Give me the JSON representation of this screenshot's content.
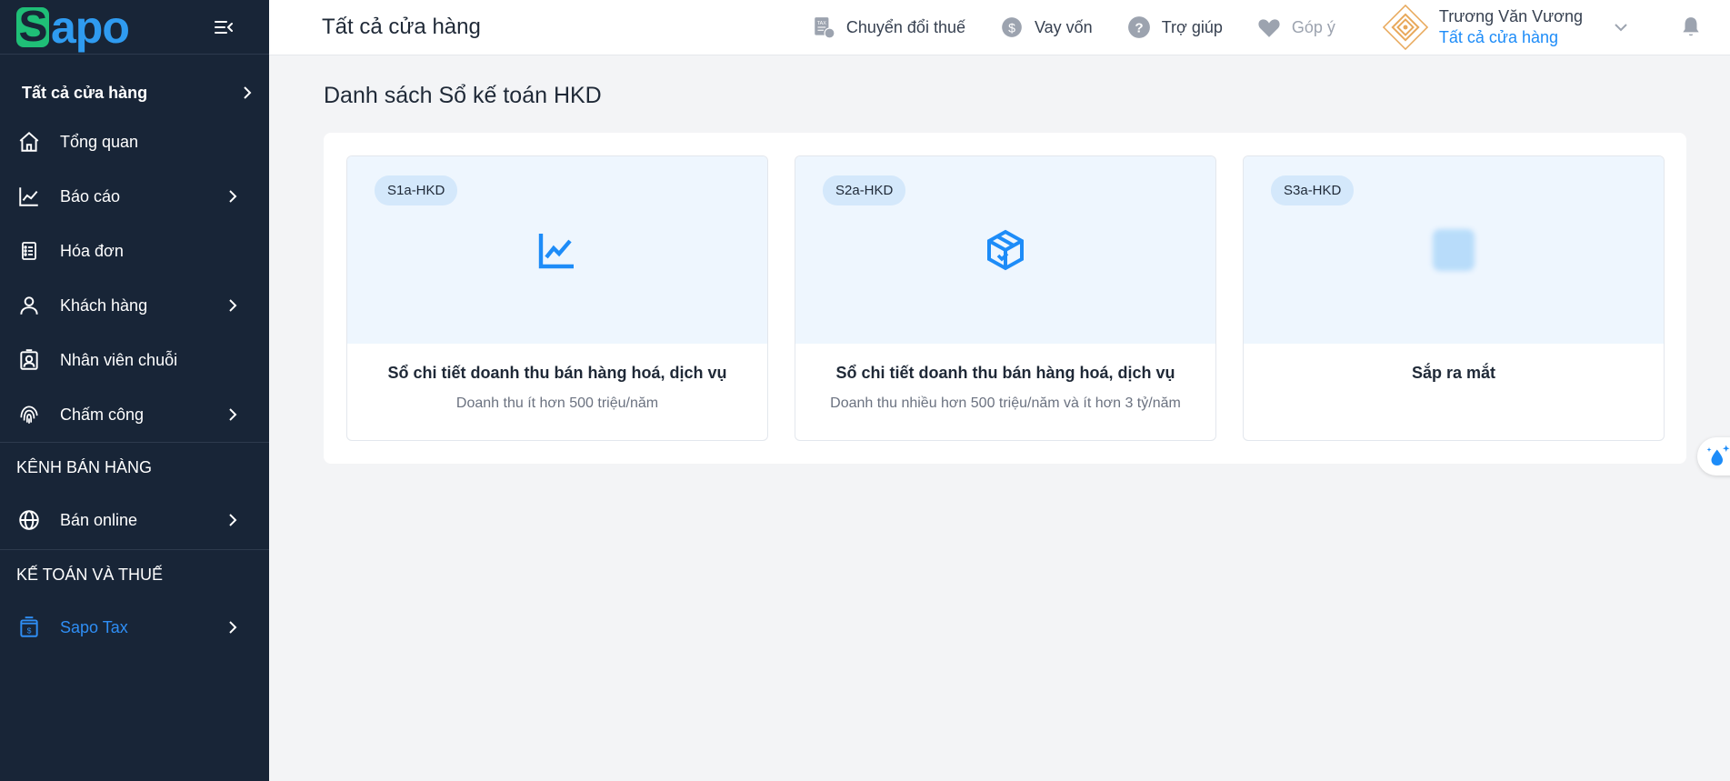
{
  "brand": {
    "logo_text": "apo",
    "logo_initial": "S"
  },
  "sidebar": {
    "store_label": "Tất cả cửa hàng",
    "items": [
      {
        "label": "Tổng quan",
        "icon": "home-icon"
      },
      {
        "label": "Báo cáo",
        "icon": "chart-line-icon"
      },
      {
        "label": "Hóa đơn",
        "icon": "invoice-icon"
      },
      {
        "label": "Khách hàng",
        "icon": "user-icon"
      },
      {
        "label": "Nhân viên chuỗi",
        "icon": "employee-badge-icon"
      },
      {
        "label": "Chấm công",
        "icon": "fingerprint-icon"
      }
    ],
    "section_sales": "KÊNH BÁN HÀNG",
    "sales_items": [
      {
        "label": "Bán online",
        "icon": "globe-icon"
      }
    ],
    "section_tax": "KẾ TOÁN VÀ THUẾ",
    "tax_items": [
      {
        "label": "Sapo Tax",
        "icon": "tax-book-icon"
      }
    ]
  },
  "header": {
    "title": "Tất cả cửa hàng",
    "actions": [
      {
        "label": "Chuyển đổi thuế",
        "icon": "tax-convert-icon"
      },
      {
        "label": "Vay vốn",
        "icon": "dollar-icon"
      },
      {
        "label": "Trợ giúp",
        "icon": "help-icon"
      },
      {
        "label": "Góp ý",
        "icon": "heart-icon"
      }
    ],
    "user": {
      "name": "Trương Văn Vương",
      "store": "Tất cả cửa hàng"
    }
  },
  "main": {
    "page_title": "Danh sách Sổ kế toán HKD",
    "cards": [
      {
        "badge": "S1a-HKD",
        "title": "Sổ chi tiết doanh thu bán hàng hoá, dịch vụ",
        "subtitle": "Doanh thu ít hơn 500 triệu/năm",
        "icon": "chart-line-icon"
      },
      {
        "badge": "S2a-HKD",
        "title": "Sổ chi tiết doanh thu bán hàng hoá, dịch vụ",
        "subtitle": "Doanh thu nhiều hơn 500 triệu/năm và ít hơn 3 tỷ/năm",
        "icon": "box-icon"
      },
      {
        "badge": "S3a-HKD",
        "title": "Sắp ra mắt",
        "subtitle": "",
        "icon": "placeholder-icon"
      }
    ]
  },
  "colors": {
    "sidebar_bg": "#182537",
    "accent": "#1d8cf8",
    "logo_green": "#1fbf77"
  }
}
